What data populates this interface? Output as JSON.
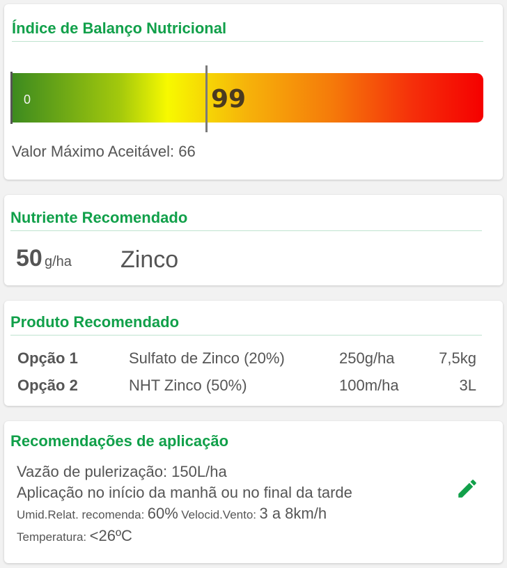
{
  "balance_index": {
    "title": "Índice de Balanço Nutricional",
    "scale_min_label": "0",
    "value": "99",
    "value_level_fraction": 0.42,
    "max_acceptable_text": "Valor Máximo Aceitável: 66",
    "gradient_colors": [
      "#3c8a1f",
      "#f7f900",
      "#f50000"
    ]
  },
  "recommended_nutrient": {
    "title": "Nutriente Recomendado",
    "dose_value": "50",
    "dose_unit": "g/ha",
    "nutrient": "Zinco"
  },
  "recommended_product": {
    "title": "Produto Recomendado",
    "options": [
      {
        "label": "Opção 1",
        "product": "Sulfato de Zinco (20%)",
        "dose": "250g/ha",
        "total": "7,5kg"
      },
      {
        "label": "Opção 2",
        "product": "NHT Zinco (50%)",
        "dose": "100m/ha",
        "total": "3L"
      }
    ]
  },
  "application": {
    "title": "Recomendações de aplicação",
    "flow_rate": "Vazão de pulerização: 150L/ha",
    "timing": "Aplicação no início da manhã ou no final da tarde",
    "humidity_label": "Umid.Relat. recomenda:",
    "humidity_value": "60%",
    "wind_label": "Velocid.Vento:",
    "wind_value": "3 a 8km/h",
    "temperature_label": "Temperatura:",
    "temperature_value": "<26ºC",
    "edit_icon": "pencil-icon"
  },
  "colors": {
    "accent": "#11a04a",
    "text": "#555555",
    "card_background": "#ffffff",
    "page_background": "#f2f2f2"
  }
}
